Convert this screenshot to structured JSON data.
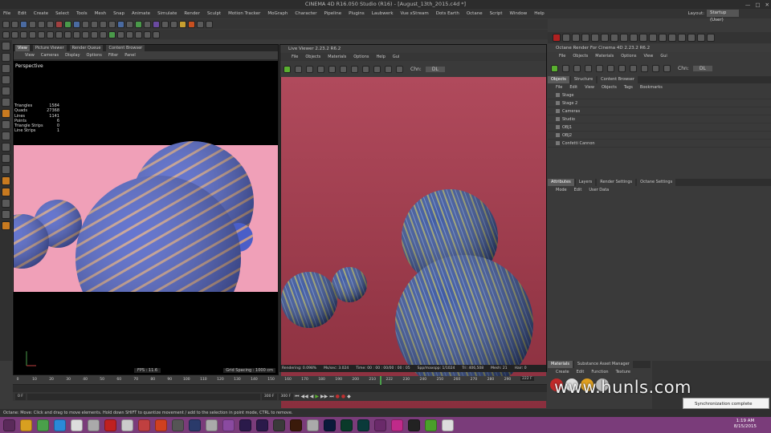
{
  "title": "CINEMA 4D R16.050 Studio (R16) - [August_13th_2015.c4d *]",
  "menubar": [
    "File",
    "Edit",
    "Create",
    "Select",
    "Tools",
    "Mesh",
    "Snap",
    "Animate",
    "Simulate",
    "Render",
    "Sculpt",
    "Motion Tracker",
    "MoGraph",
    "Character",
    "Pipeline",
    "Plugins",
    "Laubwerk",
    "Vue xStream",
    "Dots Earth",
    "Octane",
    "Script",
    "Window",
    "Help"
  ],
  "layout": {
    "label": "Layout:",
    "value": "Startup (User)"
  },
  "viewport": {
    "tabs": [
      "View",
      "Picture Viewer",
      "Render Queue",
      "Content Browser"
    ],
    "menu": [
      "View",
      "Cameras",
      "Display",
      "Options",
      "Filter",
      "Panel"
    ],
    "label": "Perspective",
    "stats": [
      {
        "k": "Triangles",
        "v": "1584"
      },
      {
        "k": "Quads",
        "v": "27368"
      },
      {
        "k": "Lines",
        "v": "1141"
      },
      {
        "k": "Points",
        "v": "6"
      },
      {
        "k": "Triangle Strips",
        "v": "0"
      },
      {
        "k": "Line Strips",
        "v": "1"
      }
    ],
    "fps": "FPS : 11.6",
    "grid": "Grid Spacing : 1000 cm"
  },
  "live_viewer": {
    "title": "Live Viewer 2.23.2 R6.2",
    "menu": [
      "File",
      "Objects",
      "Materials",
      "Options",
      "Help",
      "Gui"
    ],
    "chn_label": "Chn:",
    "chn_value": "DL",
    "status": [
      "Rendering: 0.098%",
      "Ms/sec: 3.024",
      "Time: 00 : 00 : 00/00 : 00 : 05",
      "Spp/maxspp: 1/1024",
      "Tri: 406,508",
      "Mesh: 21",
      "Hair: 0"
    ]
  },
  "right_panel": {
    "title": "Octane Render For Cinema 4D 2.23.2 R6.2",
    "menu": [
      "File",
      "Objects",
      "Materials",
      "Options",
      "View",
      "Gui"
    ],
    "chn_label": "Chn:",
    "chn_value": "DL",
    "obj_tabs": [
      "Objects",
      "Structure",
      "Content Browser"
    ],
    "obj_menu": [
      "File",
      "Edit",
      "View",
      "Objects",
      "Tags",
      "Bookmarks"
    ],
    "objects": [
      "Stage",
      "Stage 2",
      "Cameras",
      "Studio",
      "OBJ1",
      "OBJ2",
      "Confetti Cannon"
    ],
    "attr_tabs": [
      "Attributes",
      "Layers",
      "Render Settings",
      "Octane Settings"
    ],
    "attr_menu": [
      "Mode",
      "Edit",
      "User Data"
    ]
  },
  "timeline": {
    "ticks": [
      "0",
      "10",
      "20",
      "30",
      "40",
      "50",
      "60",
      "70",
      "80",
      "90",
      "100",
      "110",
      "120",
      "130",
      "140",
      "150",
      "160",
      "170",
      "180",
      "190",
      "200",
      "210",
      "222",
      "230",
      "240",
      "250",
      "260",
      "270",
      "280",
      "290"
    ],
    "current": "222 F",
    "start": "0 F",
    "end": "300 F",
    "range_end": "300 F"
  },
  "materials": {
    "tabs": [
      "Materials",
      "Substance Asset Manager"
    ],
    "menu": [
      "Create",
      "Edit",
      "Function",
      "Texture"
    ]
  },
  "statusbar": "Octane:    Move: Click and drag to move elements. Hold down SHIFT to quantize movement / add to the selection in point mode, CTRL to remove.",
  "watermark": "www.hunls.com",
  "toast": "Synchronization complete",
  "clock": {
    "time": "1:19 AM",
    "date": "8/15/2015"
  },
  "colors": {
    "taskbar": "#7a3c7a",
    "accent": "#5a7fb0"
  }
}
